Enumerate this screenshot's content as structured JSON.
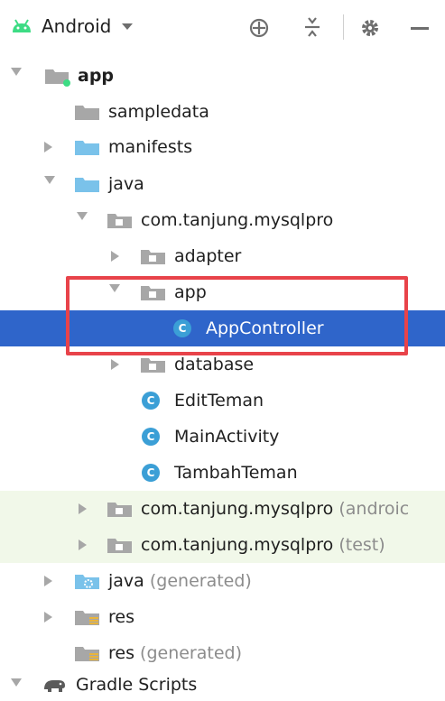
{
  "toolbar": {
    "view_label": "Android",
    "icons": [
      "android-icon",
      "chevron-down-icon",
      "crosshair-icon",
      "collapse-all-icon",
      "gear-icon",
      "minimize-icon"
    ]
  },
  "tree": {
    "app": "app",
    "sampledata": "sampledata",
    "manifests": "manifests",
    "java": "java",
    "pkg_main": "com.tanjung.mysqlpro",
    "adapter": "adapter",
    "app_pkg": "app",
    "appcontroller": "AppController",
    "database": "database",
    "editteman": "EditTeman",
    "mainactivity": "MainActivity",
    "tambahteman": "TambahTeman",
    "pkg_android": "com.tanjung.mysqlpro",
    "pkg_android_suffix": "(androic",
    "pkg_test": "com.tanjung.mysqlpro",
    "pkg_test_suffix": "(test)",
    "java_generated": "java",
    "java_generated_suffix": "(generated)",
    "res": "res",
    "res_generated": "res",
    "res_generated_suffix": "(generated)",
    "gradle_scripts": "Gradle Scripts",
    "class_icon_letter": "C"
  },
  "colors": {
    "selection": "#2f65ca",
    "highlight_border": "#e8434a",
    "test_row_bg": "#f1f8e9",
    "folder_blue": "#7ac2ea",
    "folder_gray": "#a7a7a7",
    "android_green": "#3ddc84"
  }
}
